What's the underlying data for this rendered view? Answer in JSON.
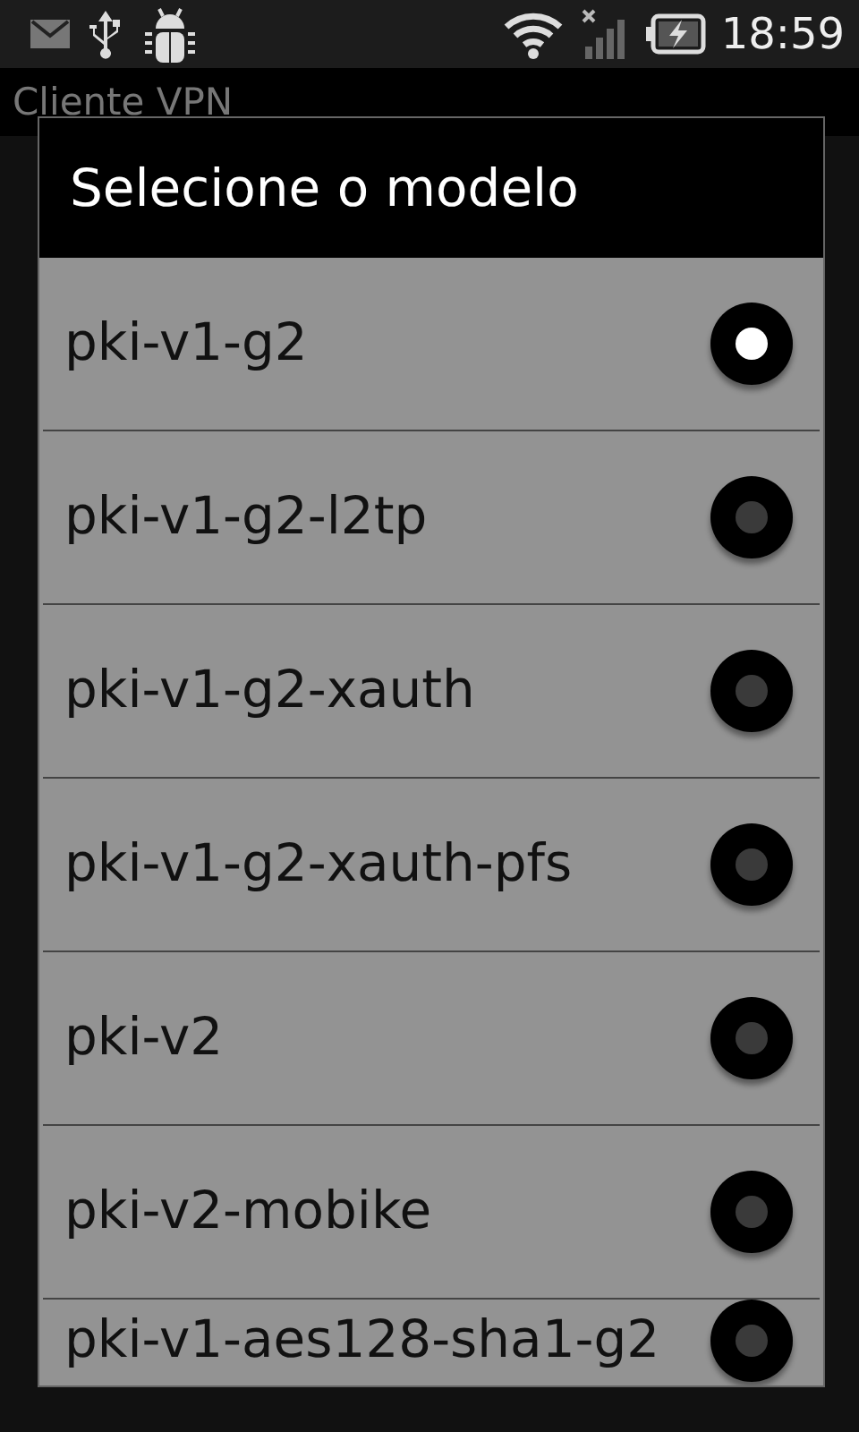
{
  "status_bar": {
    "time": "18:59"
  },
  "app_bar": {
    "title": "Cliente VPN"
  },
  "dialog": {
    "title": "Selecione o modelo",
    "options": [
      {
        "label": "pki-v1-g2",
        "selected": true
      },
      {
        "label": "pki-v1-g2-l2tp",
        "selected": false
      },
      {
        "label": "pki-v1-g2-xauth",
        "selected": false
      },
      {
        "label": "pki-v1-g2-xauth-pfs",
        "selected": false
      },
      {
        "label": "pki-v2",
        "selected": false
      },
      {
        "label": "pki-v2-mobike",
        "selected": false
      },
      {
        "label": "pki-v1-aes128-sha1-g2",
        "selected": false
      }
    ]
  }
}
